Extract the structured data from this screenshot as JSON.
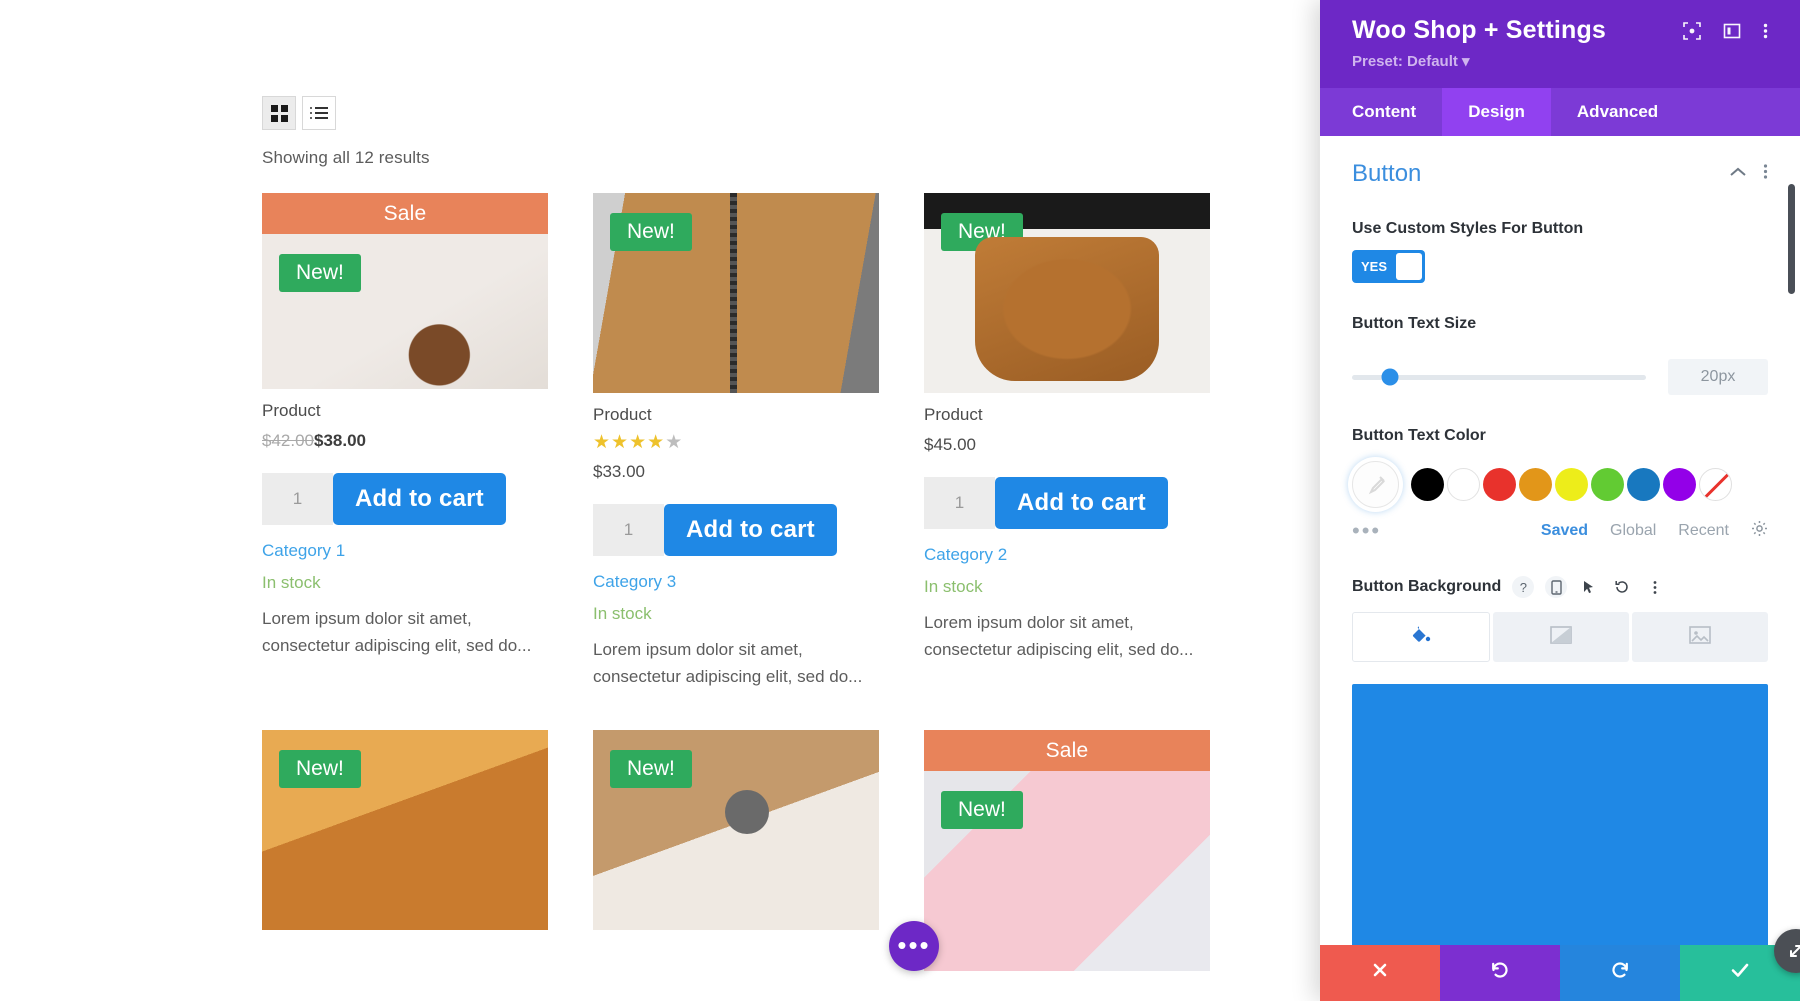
{
  "shop": {
    "view_toggle": {
      "grid_label": "grid-view",
      "list_label": "list-view"
    },
    "results_text": "Showing all 12 results",
    "labels": {
      "sale": "Sale",
      "new": "New!",
      "add_to_cart": "Add to cart",
      "in_stock": "In stock",
      "qty": "1"
    },
    "products": [
      {
        "sale_banner": "Sale",
        "new_badge": "New!",
        "title": "Product",
        "rating": null,
        "price_old": "$42.00",
        "price": "$38.00",
        "qty": "1",
        "add_to_cart": "Add to cart",
        "category": "Category 1",
        "stock": "In stock",
        "description": "Lorem ipsum dolor sit amet, consectetur adipiscing elit, sed do..."
      },
      {
        "sale_banner": null,
        "new_badge": "New!",
        "title": "Product",
        "rating": 3.5,
        "price_old": null,
        "price": "$33.00",
        "qty": "1",
        "add_to_cart": "Add to cart",
        "category": "Category 3",
        "stock": "In stock",
        "description": "Lorem ipsum dolor sit amet, consectetur adipiscing elit, sed do..."
      },
      {
        "sale_banner": null,
        "new_badge": "New!",
        "title": "Product",
        "rating": null,
        "price_old": null,
        "price": "$45.00",
        "qty": "1",
        "add_to_cart": "Add to cart",
        "category": "Category 2",
        "stock": "In stock",
        "description": "Lorem ipsum dolor sit amet, consectetur adipiscing elit, sed do..."
      },
      {
        "sale_banner": null,
        "new_badge": "New!",
        "title": "Product"
      },
      {
        "sale_banner": null,
        "new_badge": "New!",
        "title": "Product"
      },
      {
        "sale_banner": "Sale",
        "new_badge": "New!",
        "title": "Product"
      }
    ],
    "fab_dots": "•••"
  },
  "panel": {
    "title": "Woo Shop + Settings",
    "preset": "Preset: Default",
    "header_icons": [
      "focus-icon",
      "layout-icon",
      "kebab-menu-icon"
    ],
    "tabs": [
      {
        "label": "Content",
        "active": false
      },
      {
        "label": "Design",
        "active": true
      },
      {
        "label": "Advanced",
        "active": false
      }
    ],
    "section": {
      "title": "Button",
      "collapse_icon": "chevron-up-icon",
      "menu_icon": "kebab-menu-icon"
    },
    "custom_styles": {
      "label": "Use Custom Styles For Button",
      "toggle_value": "YES"
    },
    "text_size": {
      "label": "Button Text Size",
      "value": "20px",
      "slider_percent": 13
    },
    "text_color": {
      "label": "Button Text Color",
      "picker_icon": "eyedropper-icon",
      "swatches": [
        "#000000",
        "#ffffff",
        "#e8322c",
        "#e29619",
        "#eded1a",
        "#62cb33",
        "#1878bf",
        "#9300e8"
      ],
      "none_swatch": "transparent-none",
      "more_dots": "•••",
      "tabs": [
        {
          "label": "Saved",
          "active": true
        },
        {
          "label": "Global",
          "active": false
        },
        {
          "label": "Recent",
          "active": false
        }
      ],
      "gear_icon": "gear-icon"
    },
    "background": {
      "label": "Button Background",
      "control_icons": [
        "help-icon",
        "responsive-icon",
        "hover-icon",
        "reset-icon",
        "kebab-menu-icon"
      ],
      "type_tabs": [
        {
          "icon": "paint-bucket-icon",
          "active": true
        },
        {
          "icon": "gradient-icon",
          "active": false
        },
        {
          "icon": "image-icon",
          "active": false
        }
      ],
      "preview_color": "#1f88e5"
    },
    "footer": [
      {
        "name": "cancel",
        "icon": "close-icon",
        "color": "#ef5a4f"
      },
      {
        "name": "undo",
        "icon": "undo-icon",
        "color": "#7c2fd0"
      },
      {
        "name": "redo",
        "icon": "redo-icon",
        "color": "#2585dd"
      },
      {
        "name": "save",
        "icon": "check-icon",
        "color": "#27bf9b"
      }
    ],
    "resize_handle_icon": "resize-diagonal-icon"
  }
}
